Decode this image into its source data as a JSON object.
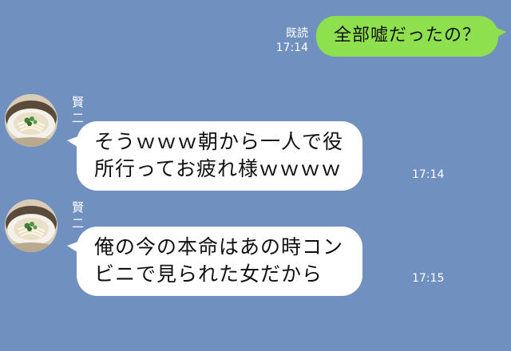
{
  "messages": {
    "outgoing": {
      "text": "全部嘘だったの？",
      "read_label": "既読",
      "time": "17:14"
    },
    "incoming": [
      {
        "sender": "賢二",
        "lines": [
          "そうｗｗｗ朝から一人で役",
          "所行ってお疲れ様ｗｗｗｗ"
        ],
        "time": "17:14"
      },
      {
        "sender": "賢二",
        "lines": [
          "俺の今の本命はあの時コン",
          "ビニで見られた女だから"
        ],
        "time": "17:15"
      }
    ]
  },
  "colors": {
    "background": "#7090c0",
    "outgoing_bubble": "#8ee04f",
    "incoming_bubble": "#ffffff"
  },
  "icons": {
    "avatar": "udon-bowl-photo"
  }
}
